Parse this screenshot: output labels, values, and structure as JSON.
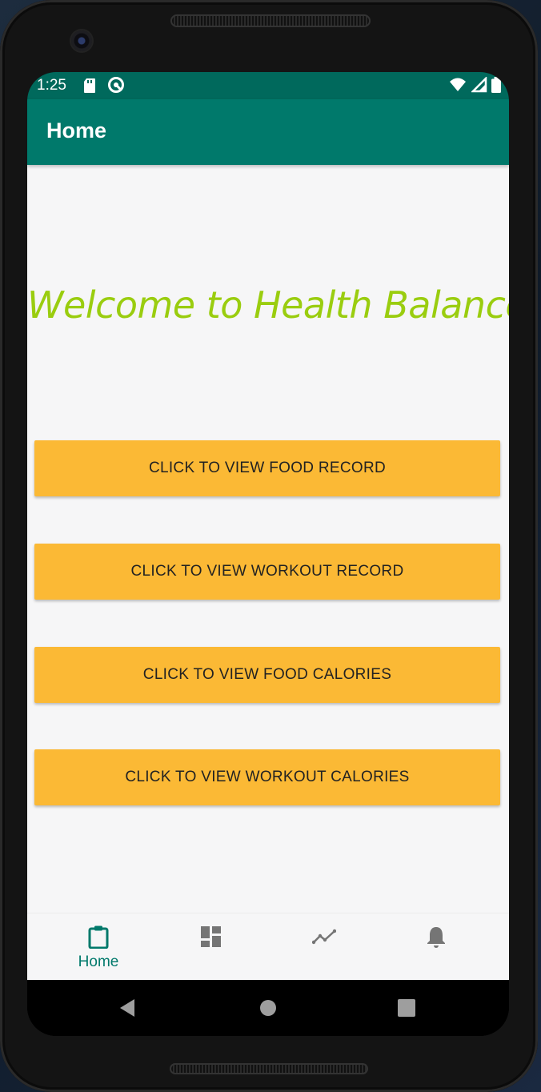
{
  "status_bar": {
    "time": "1:25",
    "icons": [
      "sd-card-icon",
      "vpn-icon",
      "wifi-icon",
      "signal-icon",
      "battery-icon"
    ]
  },
  "app_bar": {
    "title": "Home"
  },
  "main": {
    "welcome_text": "Welcome to Health Balancer",
    "buttons": [
      {
        "label": "CLICK TO VIEW FOOD RECORD"
      },
      {
        "label": "CLICK TO VIEW WORKOUT RECORD"
      },
      {
        "label": "CLICK TO VIEW FOOD CALORIES"
      },
      {
        "label": "CLICK TO VIEW WORKOUT CALORIES"
      }
    ]
  },
  "bottom_nav": {
    "items": [
      {
        "label": "Home",
        "icon": "clipboard-icon",
        "selected": true
      },
      {
        "label": "",
        "icon": "dashboard-icon",
        "selected": false
      },
      {
        "label": "",
        "icon": "trend-line-icon",
        "selected": false
      },
      {
        "label": "",
        "icon": "bell-icon",
        "selected": false
      }
    ]
  },
  "system_nav": {
    "icons": [
      "back-icon",
      "home-circle-icon",
      "recents-icon"
    ]
  },
  "colors": {
    "status_bar": "#00695c",
    "app_bar": "#00796b",
    "accent_teal": "#00796b",
    "button": "#fbb935",
    "welcome_text": "#9acd0f",
    "background": "#f6f6f7"
  }
}
